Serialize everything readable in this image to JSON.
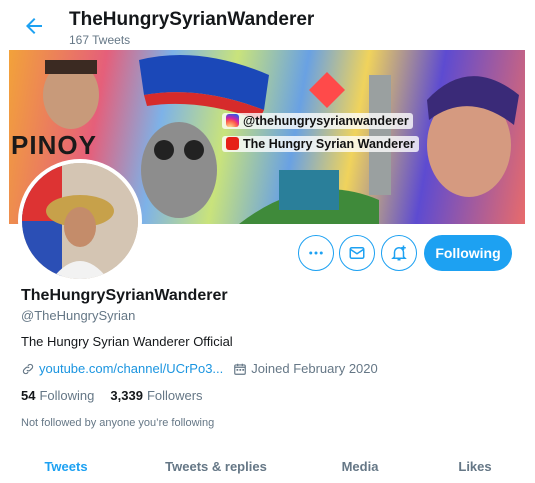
{
  "header": {
    "profile_name": "TheHungrySyrianWanderer",
    "tweet_count": "167 Tweets"
  },
  "banner": {
    "instagram_handle": "@thehungrysyrianwanderer",
    "youtube_channel": "The Hungry Syrian Wanderer",
    "banner_word": "PINOY"
  },
  "actions": {
    "more_icon": "more-icon",
    "message_icon": "mail-icon",
    "notify_icon": "bell-plus-icon",
    "follow_label": "Following"
  },
  "profile": {
    "display_name": "TheHungrySyrianWanderer",
    "handle": "@TheHungrySyrian",
    "bio": "The Hungry Syrian Wanderer Official",
    "link": "youtube.com/channel/UCrPo3...",
    "joined": "Joined February 2020"
  },
  "stats": {
    "following_count": "54",
    "following_label": "Following",
    "followers_count": "3,339",
    "followers_label": "Followers"
  },
  "not_followed": "Not followed by anyone you’re following",
  "tabs": [
    {
      "label": "Tweets",
      "active": true
    },
    {
      "label": "Tweets & replies",
      "active": false
    },
    {
      "label": "Media",
      "active": false
    },
    {
      "label": "Likes",
      "active": false
    }
  ],
  "colors": {
    "accent": "#1da1f2",
    "link": "#1b95e0",
    "secondary_text": "#657786"
  }
}
